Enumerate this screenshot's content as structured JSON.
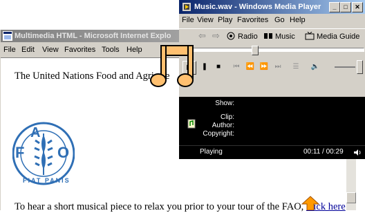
{
  "ie": {
    "title": "Multimedia HTML - Microsoft Internet Explo",
    "menu": [
      "File",
      "Edit",
      "View",
      "Favorites",
      "Tools",
      "Help"
    ],
    "heading": "The United Nations Food and Agri",
    "heading_tail": "e",
    "logo": {
      "top": "F",
      "middle": "A",
      "right": "O",
      "motto": "FIAT PANIS"
    },
    "paragraph": "To hear a short musical piece to relax you prior to your tour of the FAO, ",
    "link": "click here"
  },
  "wmp": {
    "title": "Music.wav - Windows Media Player",
    "menu": [
      "File",
      "View",
      "Play",
      "Favorites",
      "Go",
      "Help"
    ],
    "links": [
      "Radio",
      "Music",
      "Media Guide"
    ],
    "info_labels": {
      "show": "Show:",
      "clip": "Clip:",
      "author": "Author:",
      "copyright": "Copyright:"
    },
    "status": "Playing",
    "time": "00:11 / 00:29"
  },
  "colors": {
    "ie_title_bg": "#808080",
    "wmp_title_bg": "#0a246a",
    "link": "#000099",
    "note": "#ffc070",
    "arrow": "#ff9900",
    "fao_blue": "#2f6fb5"
  },
  "icons": [
    "ie-logo-icon",
    "wmp-logo-icon",
    "music-note-icon",
    "up-arrow-icon",
    "speaker-icon"
  ]
}
